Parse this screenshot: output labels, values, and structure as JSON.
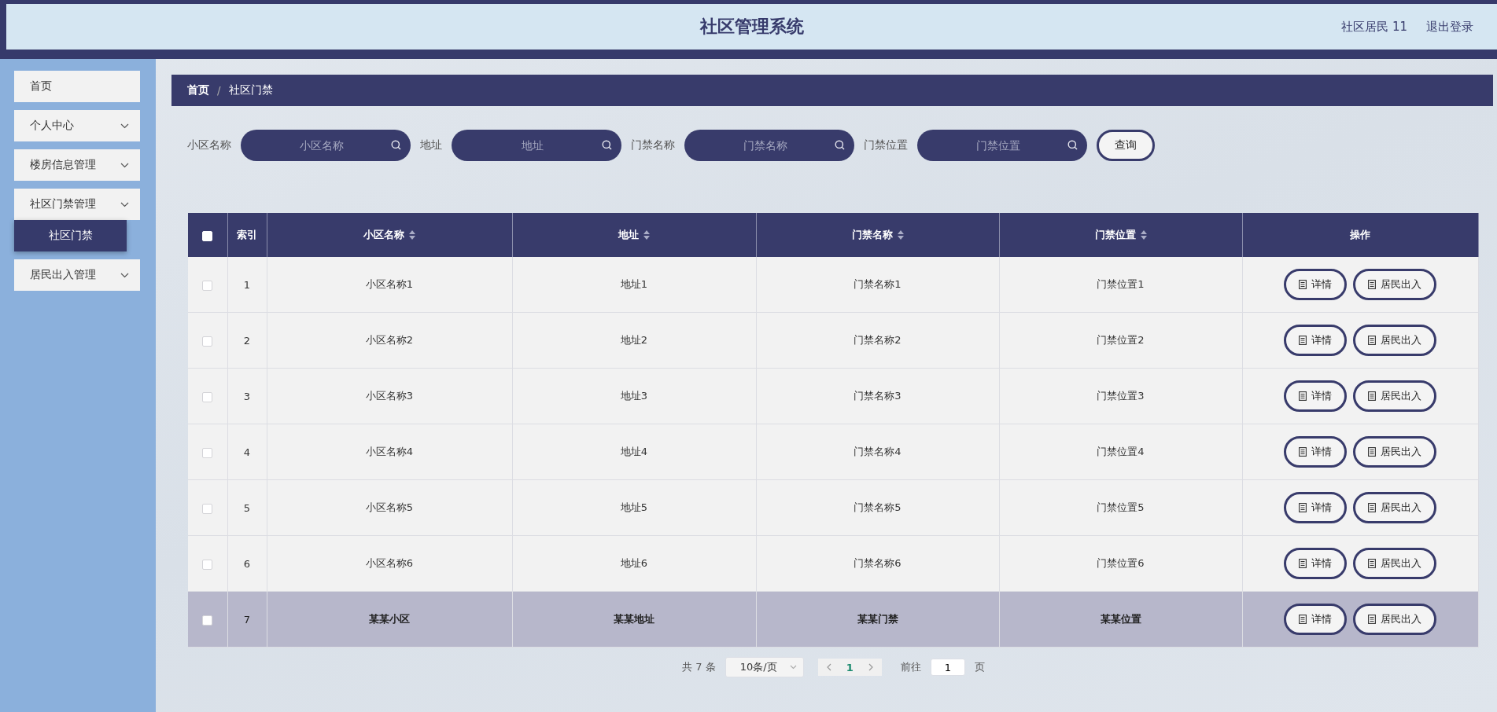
{
  "header": {
    "title": "社区管理系统",
    "user": "社区居民 11",
    "logout": "退出登录"
  },
  "sidebar": {
    "items": [
      {
        "label": "首页",
        "kind": "link",
        "selected": false
      },
      {
        "label": "个人中心",
        "kind": "submenu"
      },
      {
        "label": "楼房信息管理",
        "kind": "submenu"
      },
      {
        "label": "社区门禁管理",
        "kind": "submenu",
        "children": [
          {
            "label": "社区门禁",
            "selected": true
          }
        ]
      },
      {
        "label": "居民出入管理",
        "kind": "submenu"
      }
    ]
  },
  "breadcrumb": {
    "separator": "/",
    "items": [
      "首页",
      "社区门禁"
    ]
  },
  "search": {
    "fields": [
      {
        "label": "小区名称",
        "placeholder": "小区名称"
      },
      {
        "label": "地址",
        "placeholder": "地址"
      },
      {
        "label": "门禁名称",
        "placeholder": "门禁名称"
      },
      {
        "label": "门禁位置",
        "placeholder": "门禁位置"
      }
    ],
    "button": "查询"
  },
  "table": {
    "columns": [
      {
        "kind": "checkbox",
        "checked": false
      },
      {
        "kind": "text",
        "label": "索引",
        "sortable": false
      },
      {
        "kind": "text",
        "label": "小区名称",
        "sortable": true
      },
      {
        "kind": "text",
        "label": "地址",
        "sortable": true
      },
      {
        "kind": "text",
        "label": "门禁名称",
        "sortable": true
      },
      {
        "kind": "text",
        "label": "门禁位置",
        "sortable": true
      },
      {
        "kind": "text",
        "label": "操作",
        "sortable": false
      }
    ],
    "rows": [
      {
        "cells": [
          "",
          "1",
          "小区名称1",
          "地址1",
          "门禁名称1",
          "门禁位置1"
        ],
        "checked": false,
        "highlighted": false,
        "actions": [
          "详情",
          "居民出入"
        ]
      },
      {
        "cells": [
          "",
          "2",
          "小区名称2",
          "地址2",
          "门禁名称2",
          "门禁位置2"
        ],
        "checked": false,
        "highlighted": false,
        "actions": [
          "详情",
          "居民出入"
        ]
      },
      {
        "cells": [
          "",
          "3",
          "小区名称3",
          "地址3",
          "门禁名称3",
          "门禁位置3"
        ],
        "checked": false,
        "highlighted": false,
        "actions": [
          "详情",
          "居民出入"
        ]
      },
      {
        "cells": [
          "",
          "4",
          "小区名称4",
          "地址4",
          "门禁名称4",
          "门禁位置4"
        ],
        "checked": false,
        "highlighted": false,
        "actions": [
          "详情",
          "居民出入"
        ]
      },
      {
        "cells": [
          "",
          "5",
          "小区名称5",
          "地址5",
          "门禁名称5",
          "门禁位置5"
        ],
        "checked": false,
        "highlighted": false,
        "actions": [
          "详情",
          "居民出入"
        ]
      },
      {
        "cells": [
          "",
          "6",
          "小区名称6",
          "地址6",
          "门禁名称6",
          "门禁位置6"
        ],
        "checked": false,
        "highlighted": false,
        "actions": [
          "详情",
          "居民出入"
        ]
      },
      {
        "cells": [
          "",
          "7",
          "某某小区",
          "某某地址",
          "某某门禁",
          "某某位置"
        ],
        "checked": false,
        "highlighted": true,
        "actions": [
          "详情",
          "居民出入"
        ]
      }
    ]
  },
  "pagination": {
    "total": "共 7 条",
    "page_size": "10条/页",
    "pages": [
      {
        "label": "1",
        "selected": true
      }
    ],
    "goto_label": "前往",
    "goto_value": "1",
    "goto_suffix": "页"
  }
}
